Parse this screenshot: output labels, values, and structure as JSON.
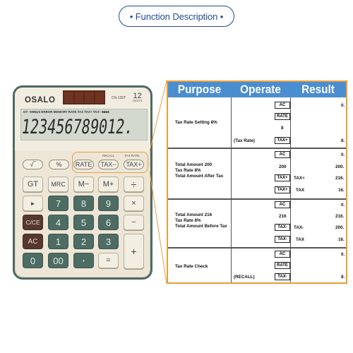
{
  "header": {
    "title": "• Function Description •"
  },
  "calculator": {
    "brand": "OSALO",
    "model": "OS-130T",
    "digits_badge": "12",
    "digits_caption": "DIGITS",
    "lcd_indicators": "GT −MINUS ERROR MEMORY RATE TAX TAX+ TAX− ■■■■",
    "lcd_display": "123456789012.",
    "label_recall": "RECALL",
    "label_taxrate": "TAX RATE",
    "keys": {
      "sqrt": "√‾",
      "percent": "%",
      "rate": "RATE",
      "tax_minus": "TAX−",
      "tax_plus": "TAX+",
      "gt": "GT",
      "mrc": "MRC",
      "m_minus": "M−",
      "m_plus": "M+",
      "divide": "÷",
      "backspace": "►",
      "seven": "7",
      "eight": "8",
      "nine": "9",
      "multiply": "×",
      "cce": "C/CE",
      "four": "4",
      "five": "5",
      "six": "6",
      "minus": "−",
      "ac": "AC",
      "one": "1",
      "two": "2",
      "three": "3",
      "plus": "+",
      "zero": "0",
      "double_zero": "00",
      "dot": "•",
      "equals": "="
    }
  },
  "table": {
    "headers": [
      "Purpose",
      "Operate",
      "Result"
    ],
    "rows": [
      {
        "purpose": [
          "Tax Rate Setting 8%"
        ],
        "steps": [
          {
            "note": "",
            "key": "AC",
            "result_label": "",
            "result": "0."
          },
          {
            "note": "",
            "key": "RATE",
            "result_label": "",
            "result": ""
          },
          {
            "note": "",
            "value": "8",
            "result_label": "",
            "result": ""
          },
          {
            "note": "(Tax Rate)",
            "key": "TAX+",
            "result_label": "",
            "result": "8."
          }
        ]
      },
      {
        "purpose": [
          "Total Amount 200",
          "Tax Rate 8%",
          "Total Amount After Tax"
        ],
        "steps": [
          {
            "note": "",
            "key": "AC",
            "result_label": "",
            "result": "0."
          },
          {
            "note": "",
            "value": "200",
            "result_label": "",
            "result": "200."
          },
          {
            "note": "",
            "key": "TAX+",
            "result_label": "TAX+",
            "result": "216."
          },
          {
            "note": "",
            "key": "TAX+",
            "result_label": "TAX",
            "result": "16."
          }
        ]
      },
      {
        "purpose": [
          "Total Amount 216",
          "Tax Rate 8%",
          "Total Amount Before Tax"
        ],
        "steps": [
          {
            "note": "",
            "key": "AC",
            "result_label": "",
            "result": "0."
          },
          {
            "note": "",
            "value": "216",
            "result_label": "",
            "result": "216."
          },
          {
            "note": "",
            "key": "TAX-",
            "result_label": "TAX-",
            "result": "200."
          },
          {
            "note": "",
            "key": "TAX-",
            "result_label": "TAX",
            "result": "16."
          }
        ]
      },
      {
        "purpose": [
          "Tax Rate Check"
        ],
        "steps": [
          {
            "note": "",
            "key": "AC",
            "result_label": "",
            "result": "0."
          },
          {
            "note": "",
            "key": "RATE",
            "result_label": "",
            "result": ""
          },
          {
            "note": "(RECALL)",
            "key": "TAX-",
            "result_label": "",
            "result": "8."
          }
        ]
      }
    ]
  },
  "colors": {
    "title_blue": "#1e4c95",
    "header_blue": "#4b8ed0",
    "accent_orange": "#ea9d3a",
    "calc_body": "#ede6d6",
    "calc_frame": "#4d6a63",
    "key_dark": "#4c6c64",
    "key_brown": "#563830"
  }
}
